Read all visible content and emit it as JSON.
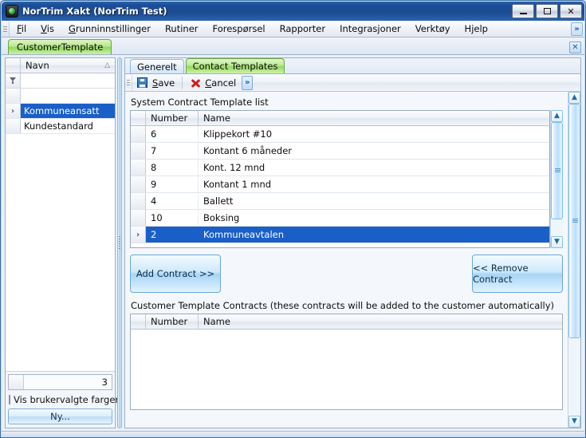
{
  "window": {
    "title": "NorTrim Xakt (NorTrim Test)",
    "icon": "app-globe-icon",
    "minimize_label": "–",
    "maximize_label": "□",
    "close_label": "✕",
    "accent_color": "#1b4b92",
    "selection_color": "#1a5fc8",
    "tab_green": "#8fd85c"
  },
  "menu": {
    "grip": "drag-grip",
    "items": [
      {
        "label": "Fil",
        "mnemonic": "F"
      },
      {
        "label": "Vis",
        "mnemonic": "V"
      },
      {
        "label": "Grunninnstillinger",
        "mnemonic": "G"
      },
      {
        "label": "Rutiner",
        "mnemonic": ""
      },
      {
        "label": "Forespørsel",
        "mnemonic": ""
      },
      {
        "label": "Rapporter",
        "mnemonic": ""
      },
      {
        "label": "Integrasjoner",
        "mnemonic": ""
      },
      {
        "label": "Verktøy",
        "mnemonic": ""
      },
      {
        "label": "Hjelp",
        "mnemonic": ""
      }
    ],
    "overflow_label": "»"
  },
  "doctabs": {
    "tabs": [
      {
        "label": "CustomerTemplate",
        "active": true
      }
    ],
    "close_label": "✕"
  },
  "left_panel": {
    "column_header": "Navn",
    "sort_indicator": "△",
    "filter_icon": "funnel-icon",
    "rows": [
      {
        "indicator": "",
        "name": "",
        "selected": false
      },
      {
        "indicator": "›",
        "name": "Kommuneansatt",
        "selected": true
      },
      {
        "indicator": "",
        "name": "Kundestandard",
        "selected": false
      }
    ],
    "count_value": "3",
    "checkbox_label": "Vis brukervalgte farger",
    "checkbox_checked": false,
    "new_button_label": "Ny..."
  },
  "right_panel": {
    "tabs": [
      {
        "label": "Generelt",
        "active": false
      },
      {
        "label": "Contact Templates",
        "active": true
      }
    ],
    "toolbar": {
      "grip": "drag-grip",
      "save_label": "Save",
      "save_mnemonic": "S",
      "cancel_label": "Cancel",
      "cancel_mnemonic": "C",
      "overflow_label": "»"
    },
    "system_list": {
      "label": "System Contract Template list",
      "columns": [
        "",
        "Number",
        "Name"
      ],
      "rows": [
        {
          "indicator": "",
          "number": "6",
          "name": "Klippekort #10",
          "selected": false
        },
        {
          "indicator": "",
          "number": "7",
          "name": "Kontant 6 måneder",
          "selected": false
        },
        {
          "indicator": "",
          "number": "8",
          "name": "Kont. 12 mnd",
          "selected": false
        },
        {
          "indicator": "",
          "number": "9",
          "name": "Kontant 1 mnd",
          "selected": false
        },
        {
          "indicator": "",
          "number": "4",
          "name": "Ballett",
          "selected": false
        },
        {
          "indicator": "",
          "number": "10",
          "name": "Boksing",
          "selected": false
        },
        {
          "indicator": "›",
          "number": "2",
          "name": "Kommuneavtalen",
          "selected": true
        }
      ]
    },
    "add_button_label": "Add Contract >>",
    "remove_button_label": "<< Remove Contract",
    "customer_list": {
      "label": "Customer Template Contracts (these contracts will be added to the customer automatically)",
      "columns": [
        "",
        "Number",
        "Name"
      ],
      "rows": []
    }
  },
  "scrollbars": {
    "up_arrow": "▲",
    "down_arrow": "▼"
  }
}
